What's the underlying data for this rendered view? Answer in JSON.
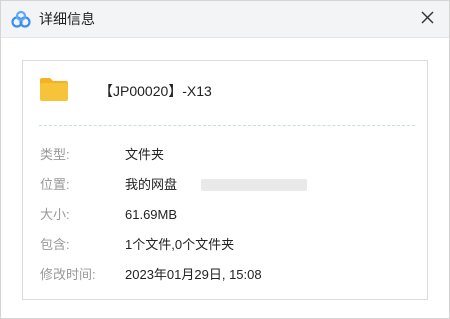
{
  "window": {
    "title": "详细信息"
  },
  "icons": {
    "app": "baidu-netdisk-cloud-icon",
    "close": "close-icon",
    "item": "folder-icon"
  },
  "item": {
    "name": "【JP00020】-X13"
  },
  "details": [
    {
      "label": "类型:",
      "value": "文件夹"
    },
    {
      "label": "位置:",
      "value": "我的网盘"
    },
    {
      "label": "大小:",
      "value": "61.69MB"
    },
    {
      "label": "包含:",
      "value": "1个文件,0个文件夹"
    },
    {
      "label": "修改时间:",
      "value": "2023年01月29日, 15:08"
    }
  ],
  "colors": {
    "folder": "#f7c439",
    "folder_tab": "#f2b224",
    "app_icon_blue": "#3a8ef6",
    "label": "#999999",
    "value": "#222222"
  }
}
